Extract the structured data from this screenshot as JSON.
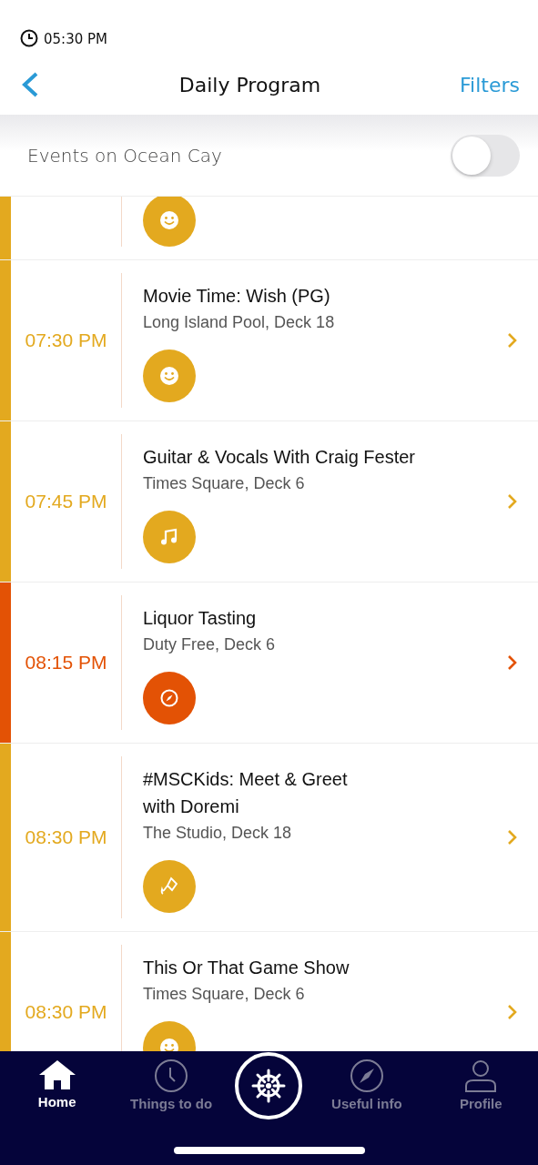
{
  "status_bar": {
    "time": "05:30 PM"
  },
  "nav": {
    "title": "Daily Program",
    "action": "Filters"
  },
  "filter": {
    "label": "Events on Ocean Cay",
    "on": false
  },
  "events": [
    {
      "partial": true,
      "kind": "smiley",
      "color": "#e3a91f"
    },
    {
      "partial": false,
      "time": "07:30 PM",
      "title": "Movie Time: Wish (PG)",
      "location": "Long Island Pool, Deck 18",
      "kind": "smiley",
      "color": "#e3a91f"
    },
    {
      "partial": false,
      "time": "07:45 PM",
      "title": "Guitar & Vocals With Craig Fester",
      "location": "Times Square, Deck 6",
      "kind": "music",
      "color": "#e3a91f"
    },
    {
      "partial": false,
      "time": "08:15 PM",
      "title": "Liquor Tasting",
      "location": "Duty Free, Deck 6",
      "kind": "compass",
      "color": "#e35205"
    },
    {
      "partial": false,
      "time": "08:30 PM",
      "title": "#MSCKids: Meet & Greet\nwith Doremi",
      "location": "The Studio, Deck 18",
      "kind": "kite",
      "color": "#e3a91f"
    },
    {
      "partial": false,
      "time": "08:30 PM",
      "title": "This Or That Game Show",
      "location": "Times Square, Deck 6",
      "kind": "smiley",
      "color": "#e3a91f"
    }
  ],
  "tab_bar": [
    {
      "kind": "home",
      "label": "Home",
      "selected": true
    },
    {
      "kind": "clock",
      "label": "Things to do",
      "selected": false
    },
    {
      "kind": "helm",
      "selected": false
    },
    {
      "kind": "compass",
      "label": "Useful info",
      "selected": false
    },
    {
      "kind": "person",
      "label": "Profile",
      "selected": false
    }
  ]
}
